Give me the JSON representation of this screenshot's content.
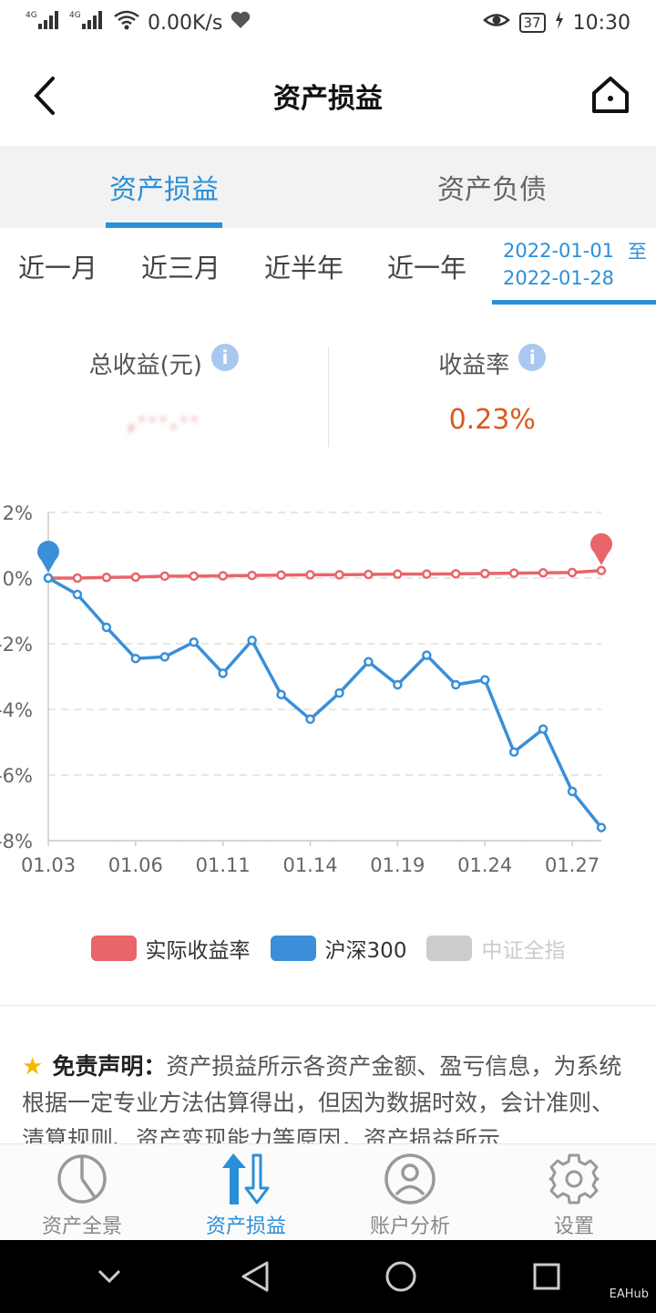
{
  "status_bar": {
    "network_1": "4G",
    "network_2": "4G",
    "speed": "0.00K/s",
    "battery": "37",
    "time": "10:30"
  },
  "header": {
    "title": "资产损益"
  },
  "main_tabs": [
    {
      "label": "资产损益",
      "active": true
    },
    {
      "label": "资产负债",
      "active": false
    }
  ],
  "periods": [
    "近一月",
    "近三月",
    "近半年",
    "近一年"
  ],
  "range": {
    "start": "2022-01-01",
    "end": "2022-01-28",
    "separator": "至"
  },
  "summary": {
    "total_label": "总收益(元)",
    "total_value": ",···.··",
    "rate_label": "收益率",
    "rate_value": "0.23%",
    "info_glyph": "i"
  },
  "chart_data": {
    "type": "line",
    "x": [
      "01.03",
      "01.04",
      "01.05",
      "01.06",
      "01.07",
      "01.10",
      "01.11",
      "01.12",
      "01.13",
      "01.14",
      "01.17",
      "01.18",
      "01.19",
      "01.20",
      "01.21",
      "01.24",
      "01.25",
      "01.26",
      "01.27",
      "01.28"
    ],
    "x_tick_labels": [
      "01.03",
      "01.06",
      "01.11",
      "01.14",
      "01.19",
      "01.24",
      "01.27"
    ],
    "y_tick_labels": [
      "2%",
      "0%",
      "-2%",
      "-4%",
      "-6%",
      "-8%"
    ],
    "ylim": [
      -8,
      2
    ],
    "grid": true,
    "series": [
      {
        "name": "实际收益率",
        "color": "#e8656a",
        "values": [
          0,
          0,
          0.02,
          0.03,
          0.06,
          0.06,
          0.07,
          0.08,
          0.09,
          0.1,
          0.1,
          0.11,
          0.12,
          0.12,
          0.13,
          0.14,
          0.15,
          0.16,
          0.17,
          0.23
        ]
      },
      {
        "name": "沪深300",
        "color": "#3a8fd8",
        "values": [
          0,
          -0.5,
          -1.5,
          -2.45,
          -2.4,
          -1.95,
          -2.9,
          -1.9,
          -3.55,
          -4.3,
          -3.5,
          -2.55,
          -3.25,
          -2.35,
          -3.25,
          -3.1,
          -5.3,
          -4.6,
          -6.5,
          -7.6
        ]
      },
      {
        "name": "中证全指",
        "color": "#cccccc",
        "values": []
      }
    ],
    "legend": "bottom"
  },
  "legend": [
    {
      "label": "实际收益率",
      "color": "#e8656a",
      "text_color": "#333333"
    },
    {
      "label": "沪深300",
      "color": "#3a8fd8",
      "text_color": "#333333"
    },
    {
      "label": "中证全指",
      "color": "#cccccc",
      "text_color": "#cccccc"
    }
  ],
  "disclaimer": {
    "star_icon": "★",
    "title": "免责声明：",
    "text": "资产损益所示各资产金额、盈亏信息，为系统根据一定专业方法估算得出，但因为数据时效，会计准则、清算规则、资产变现能力等原因，资产损益所示"
  },
  "bottom_nav": [
    {
      "label": "资产全景",
      "icon": "pie-chart-icon",
      "active": false
    },
    {
      "label": "资产损益",
      "icon": "up-down-arrows-icon",
      "active": true
    },
    {
      "label": "账户分析",
      "icon": "user-icon",
      "active": false
    },
    {
      "label": "设置",
      "icon": "gear-icon",
      "active": false
    }
  ],
  "watermark": "EAHub",
  "colors": {
    "accent": "#2b8fd8",
    "rate": "#d95a1a"
  }
}
